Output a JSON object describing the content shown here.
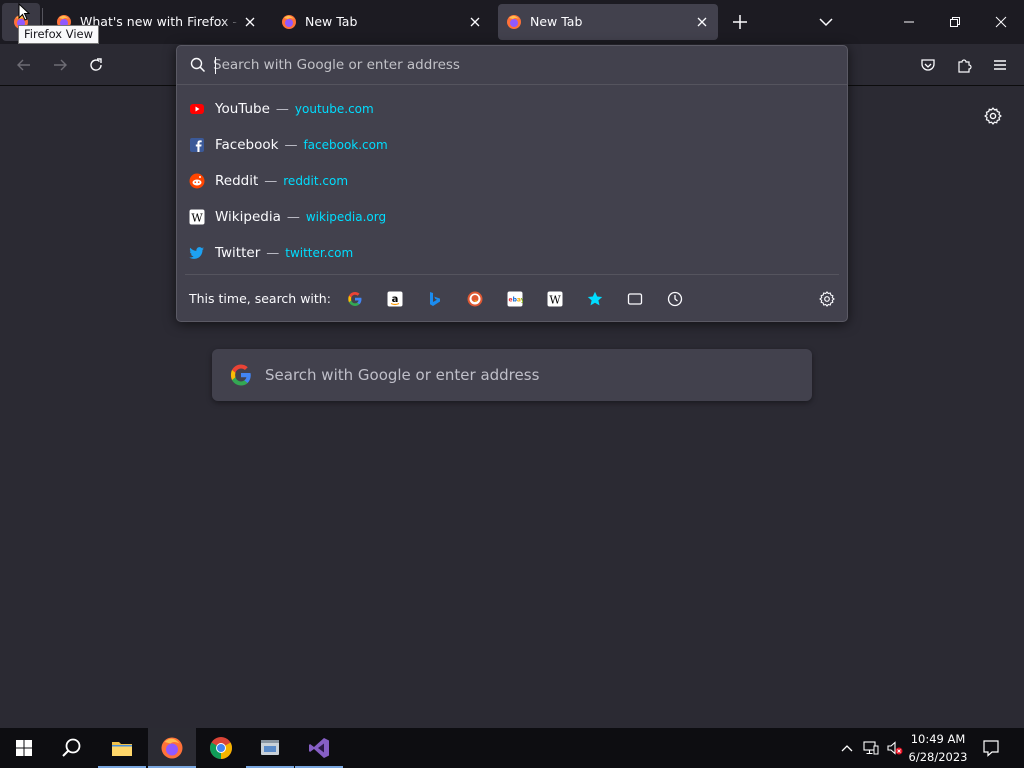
{
  "tabs": [
    {
      "title": "What's new with Firefox - More",
      "active": false
    },
    {
      "title": "New Tab",
      "active": false
    },
    {
      "title": "New Tab",
      "active": true
    }
  ],
  "tooltip": "Firefox View",
  "urlbar": {
    "placeholder": "Search with Google or enter address",
    "suggestions": [
      {
        "title": "YouTube",
        "url": "youtube.com",
        "icon": "youtube-icon"
      },
      {
        "title": "Facebook",
        "url": "facebook.com",
        "icon": "facebook-icon"
      },
      {
        "title": "Reddit",
        "url": "reddit.com",
        "icon": "reddit-icon"
      },
      {
        "title": "Wikipedia",
        "url": "wikipedia.org",
        "icon": "wikipedia-icon"
      },
      {
        "title": "Twitter",
        "url": "twitter.com",
        "icon": "twitter-icon"
      }
    ],
    "dash": "—",
    "oneoff_label": "This time, search with:",
    "oneoff_engines": [
      "google-icon",
      "amazon-icon",
      "bing-icon",
      "duckduckgo-icon",
      "ebay-icon",
      "wikipedia-icon",
      "bookmarks-icon",
      "tabs-icon",
      "history-icon"
    ]
  },
  "page": {
    "search_placeholder": "Search with Google or enter address"
  },
  "taskbar": {
    "time": "10:49 AM",
    "date": "6/28/2023"
  },
  "colors": {
    "accent_url": "#00ddff",
    "panel_bg": "#42414d",
    "page_bg": "#2b2a33",
    "tabstrip_bg": "#1c1b22"
  }
}
